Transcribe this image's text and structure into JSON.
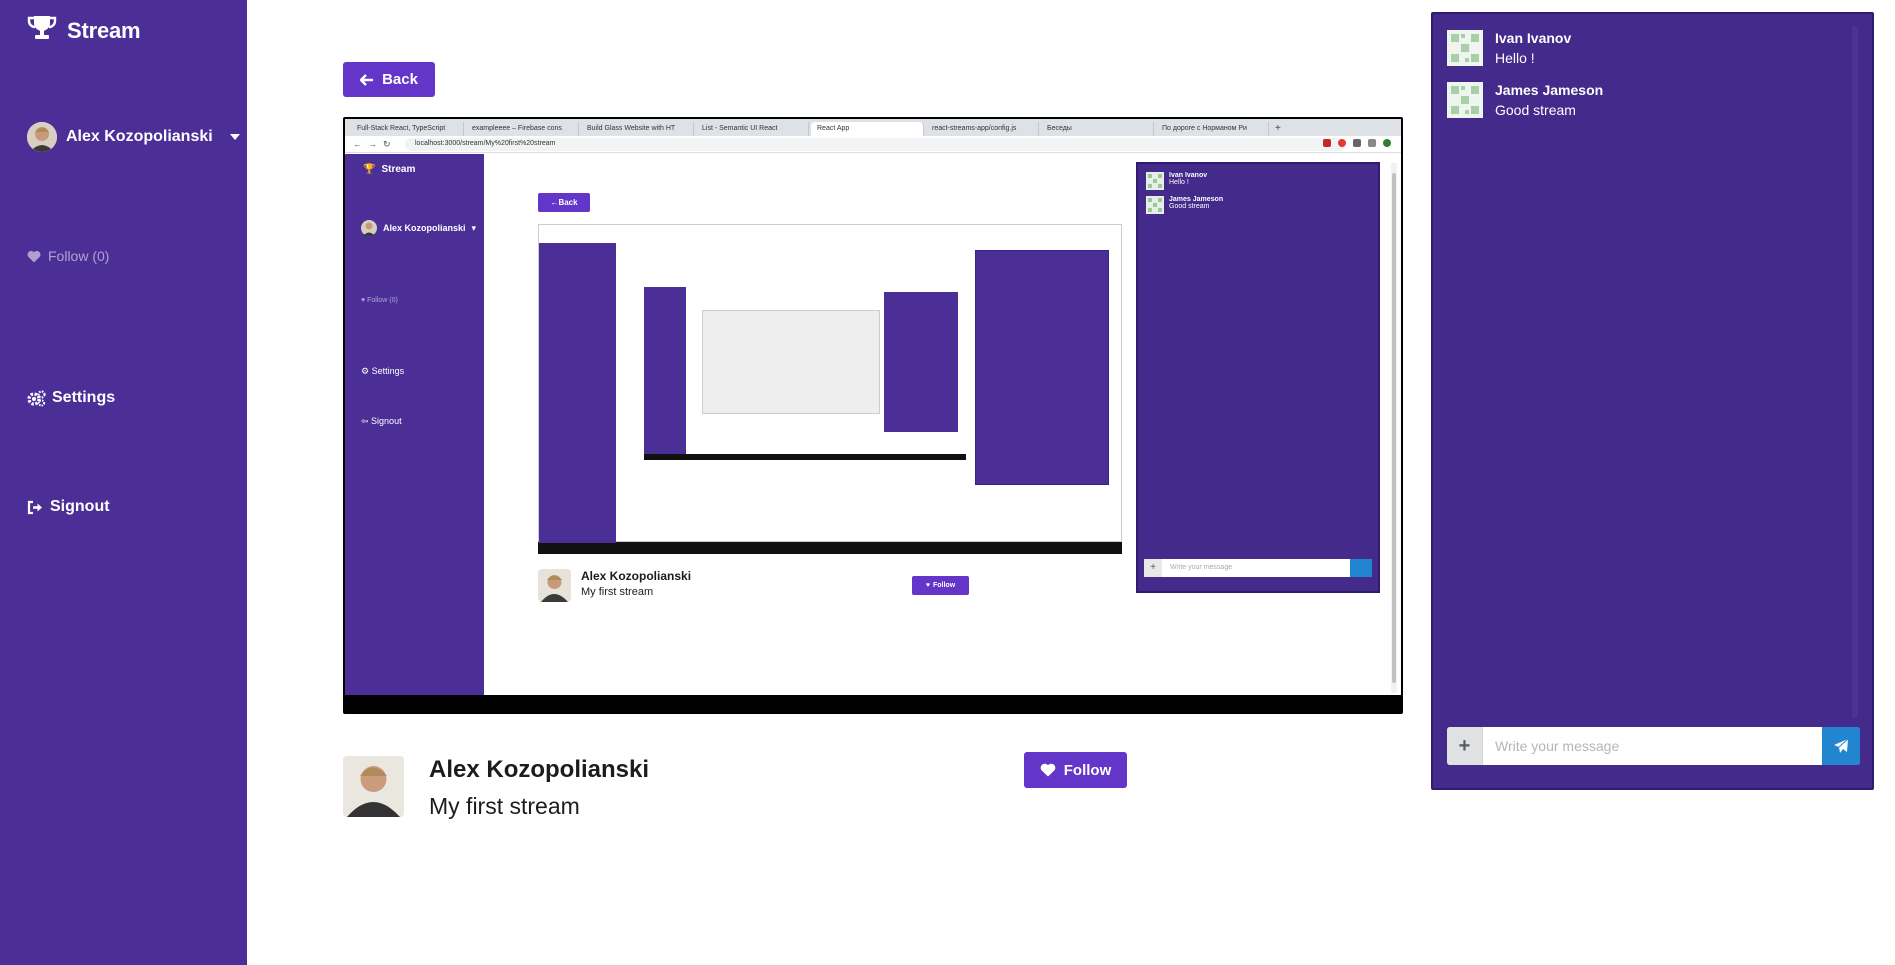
{
  "sidebar": {
    "brand": "Stream",
    "user_name": "Alex Kozopolianski",
    "follow": "Follow (0)",
    "settings": "Settings",
    "signout": "Signout"
  },
  "main": {
    "back_label": "Back",
    "streamer_name": "Alex Kozopolianski",
    "stream_title": "My first stream",
    "follow_label": "Follow"
  },
  "screen_share": {
    "tabs": [
      "Full-Stack React, TypeScript",
      "exampleeee – Firebase cons",
      "Build Glass Website with HT",
      "List - Semantic UI React",
      "React App",
      "react-streams-app/config.js",
      "Беседы",
      "По дороге с Норманом Ри"
    ],
    "url": "localhost:3000/stream/My%20first%20stream",
    "brand": "Stream",
    "user_name": "Alex Kozopolianski",
    "follow": "Follow (0)",
    "settings": "Settings",
    "signout": "Signout",
    "back": "Back",
    "streamer_name": "Alex Kozopolianski",
    "stream_title": "My first stream",
    "follow_btn": "Follow",
    "chat_placeholder": "Write your message",
    "messages": [
      {
        "author": "Ivan Ivanov",
        "text": "Hello !"
      },
      {
        "author": "James Jameson",
        "text": "Good stream"
      }
    ]
  },
  "chat": {
    "messages": [
      {
        "author": "Ivan Ivanov",
        "text": "Hello !"
      },
      {
        "author": "James Jameson",
        "text": "Good stream"
      }
    ],
    "input_placeholder": "Write your message",
    "input_value": ""
  },
  "colors": {
    "sidebar": "#4b2f96",
    "primary_button": "#6435c9",
    "chat_bg": "#432a8b",
    "send_button": "#2185d0"
  },
  "icons": {
    "brand": "trophy-icon",
    "dropdown": "caret-down-icon",
    "follow": "heart-icon",
    "settings": "cogs-icon",
    "signout": "sign-out-icon",
    "back": "arrow-left-icon",
    "attach": "plus-icon",
    "send": "paper-plane-icon"
  }
}
